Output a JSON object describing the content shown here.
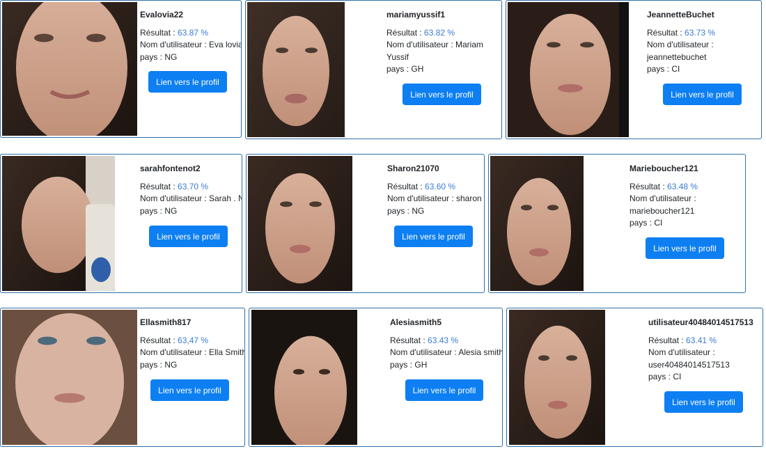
{
  "labels": {
    "result": "Résultat : ",
    "username": "Nom d'utilisateur : ",
    "country": "pays : ",
    "profile_link": "Lien vers le profil"
  },
  "colors": {
    "button_bg": "#0d7ff2",
    "card_border": "#2f6fa8",
    "score_text": "#3a7bd5"
  },
  "cards": [
    {
      "username": "Evalovia22",
      "score": "63.87 %",
      "user_name": "Eva lovia",
      "country": "NG"
    },
    {
      "username": "mariamyussif1",
      "score": "63.82 %",
      "user_name": "Mariam Yussif",
      "country": "GH"
    },
    {
      "username": "JeannetteBuchet",
      "score": "63.73 %",
      "user_name": "jeannettebuchet",
      "country": "CI"
    },
    {
      "username": "sarahfontenot2",
      "score": "63.70 %",
      "user_name": "Sarah . N",
      "country": "NG"
    },
    {
      "username": "Sharon21070",
      "score": "63.60 %",
      "user_name": "sharon",
      "country": "NG"
    },
    {
      "username": "Marieboucher121",
      "score": "63.48 %",
      "user_name": "marieboucher121",
      "country": "CI"
    },
    {
      "username": "Ellasmith817",
      "score": "63,47 %",
      "user_name": "Ella Smith",
      "country": "NG"
    },
    {
      "username": "Alesiasmith5",
      "score": "63.43 %",
      "user_name": "Alesia smith",
      "country": "GH"
    },
    {
      "username": "utilisateur40484014517513",
      "score": "63.41 %",
      "user_name": "user40484014517513",
      "country": "CI"
    }
  ]
}
